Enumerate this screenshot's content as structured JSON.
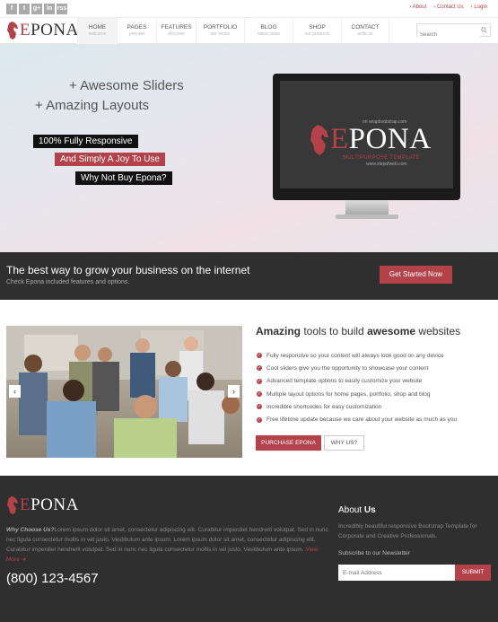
{
  "topbar": {
    "social": [
      "f",
      "t",
      "g+",
      "in",
      "rss"
    ],
    "links": [
      "About",
      "Contact Us",
      "Login"
    ]
  },
  "brand": {
    "prefix": "E",
    "rest": "PONA"
  },
  "nav": [
    {
      "label": "HOME",
      "sub": "welcome"
    },
    {
      "label": "PAGES",
      "sub": "preview"
    },
    {
      "label": "FEATURES",
      "sub": "discover"
    },
    {
      "label": "PORTFOLIO",
      "sub": "our works"
    },
    {
      "label": "BLOG",
      "sub": "latest news"
    },
    {
      "label": "SHOP",
      "sub": "our products"
    },
    {
      "label": "CONTACT",
      "sub": "write us"
    }
  ],
  "search": {
    "placeholder": "Search"
  },
  "hero": {
    "line1": "+ Awesome Sliders",
    "line2": "+ Amazing Layouts",
    "tag1": "100% Fully Responsive",
    "tag2": "And Simply A Joy To Use",
    "tag3": "Why Not Buy Epona?",
    "screen_top": "on wrapbootstrap.com",
    "screen_tagline": "MULTIPURPOSE TEMPLATE",
    "screen_url": "www.stepofweb.com"
  },
  "cta": {
    "title": "The best way to grow your business on the internet",
    "subtitle": "Check Epona included features and options.",
    "button": "Get Started Now"
  },
  "features": {
    "title_a": "Amazing",
    "title_b": " tools to build ",
    "title_c": "awesome",
    "title_d": " websites",
    "items": [
      "Fully responsive so your content will always look good on any device",
      "Cool sliders give you the opportunity to showcase your content",
      "Advanced template options to easily customize your website",
      "Multiple layout options for home pages, portfolio, shop and blog",
      "Incredible shortcodes for easy customization",
      "Free lifetime update because we care about your website as much as you"
    ],
    "purchase": "PURCHASE EPONA",
    "why": "WHY US?",
    "prev": "‹",
    "next": "›"
  },
  "footer": {
    "why_label": "Why Choose Us?",
    "about_text": "Lorem ipsum dolor sit amet, consectetur adipiscing elit. Curabitur imperdiet hendrerit volutpat. Sed in nunc nec ligula consectetur mollis in vel justo. Vestibulum ante ipsum. Lorem ipsum dolor sit amet, consectetur adipiscing elit. Curabitur imperdiet hendrerit volutpat. Sed in nunc nec ligula consectetur mollis in vel justo. Vestibulum ante ipsum.",
    "more": "View More",
    "phone": "(800) 123-4567",
    "about_a": "About ",
    "about_b": "Us",
    "about_p": "Incredibly beautiful responsive Bootstrap Template for Corporate and Creative Professionals.",
    "newsletter": "Subscribe to our Newsletter",
    "email_placeholder": "E-mail Address",
    "submit": "SUBMIT"
  },
  "colors": {
    "accent": "#b4424a",
    "dark": "#2f2f2f"
  }
}
